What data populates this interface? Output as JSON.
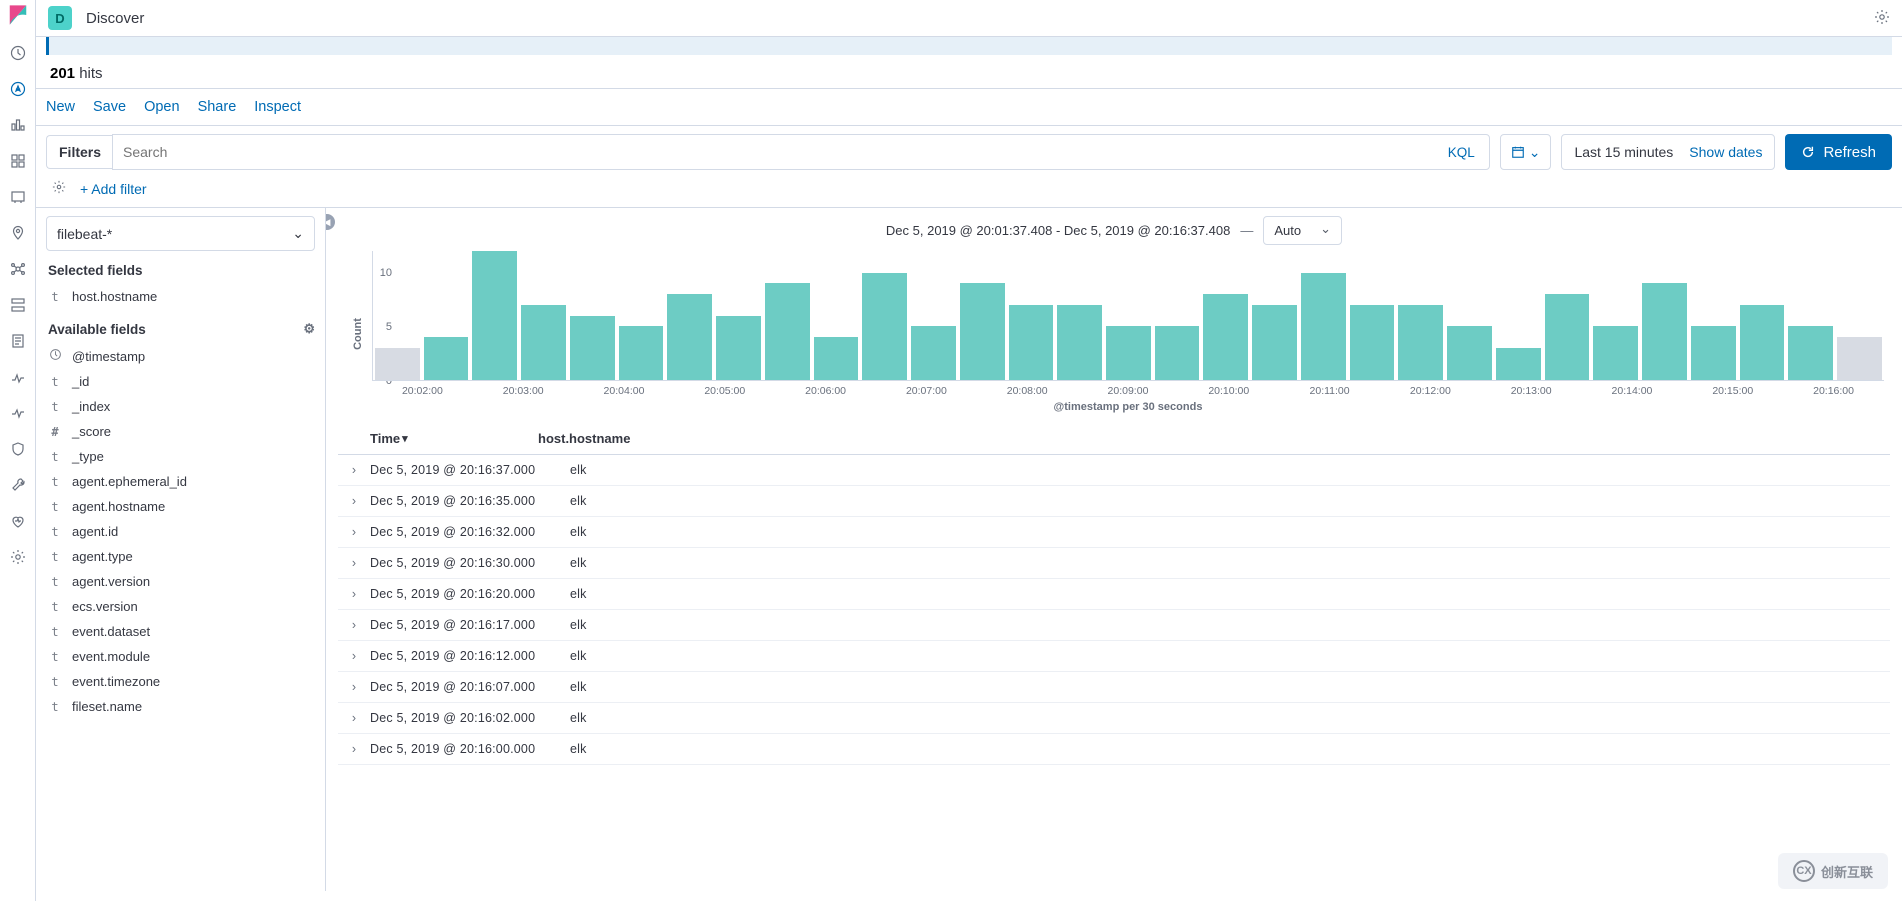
{
  "header": {
    "badge": "D",
    "title": "Discover"
  },
  "hits": {
    "count": "201",
    "label": " hits"
  },
  "toolbar": [
    "New",
    "Save",
    "Open",
    "Share",
    "Inspect"
  ],
  "search": {
    "filters": "Filters",
    "placeholder": "Search",
    "kql": "KQL"
  },
  "date": {
    "range": "Last 15 minutes",
    "show": "Show dates",
    "refresh": "Refresh"
  },
  "addfilter": "+ Add filter",
  "pattern": "filebeat-*",
  "selected_h": "Selected fields",
  "selected": [
    {
      "t": "t",
      "n": "host.hostname"
    }
  ],
  "available_h": "Available fields",
  "available": [
    {
      "t": "clock",
      "n": "@timestamp"
    },
    {
      "t": "t",
      "n": "_id"
    },
    {
      "t": "t",
      "n": "_index"
    },
    {
      "t": "hash",
      "n": "_score"
    },
    {
      "t": "t",
      "n": "_type"
    },
    {
      "t": "t",
      "n": "agent.ephemeral_id"
    },
    {
      "t": "t",
      "n": "agent.hostname"
    },
    {
      "t": "t",
      "n": "agent.id"
    },
    {
      "t": "t",
      "n": "agent.type"
    },
    {
      "t": "t",
      "n": "agent.version"
    },
    {
      "t": "t",
      "n": "ecs.version"
    },
    {
      "t": "t",
      "n": "event.dataset"
    },
    {
      "t": "t",
      "n": "event.module"
    },
    {
      "t": "t",
      "n": "event.timezone"
    },
    {
      "t": "t",
      "n": "fileset.name"
    }
  ],
  "chart_title": "Dec 5, 2019 @ 20:01:37.408 - Dec 5, 2019 @ 20:16:37.408",
  "interval": "Auto",
  "chart_data": {
    "type": "bar",
    "ylabel": "Count",
    "xlabel": "@timestamp per 30 seconds",
    "yticks": [
      0,
      5,
      10
    ],
    "ylim": [
      0,
      12
    ],
    "categories": [
      "20:02:00",
      "20:03:00",
      "20:04:00",
      "20:05:00",
      "20:06:00",
      "20:07:00",
      "20:08:00",
      "20:09:00",
      "20:10:00",
      "20:11:00",
      "20:12:00",
      "20:13:00",
      "20:14:00",
      "20:15:00",
      "20:16:00"
    ],
    "values": [
      3,
      4,
      12,
      7,
      6,
      5,
      8,
      6,
      9,
      4,
      10,
      5,
      9,
      7,
      7,
      5,
      5,
      8,
      7,
      10,
      7,
      7,
      5,
      3,
      8,
      5,
      9,
      5,
      7,
      5,
      4
    ],
    "shaded": [
      0,
      30
    ]
  },
  "table": {
    "h_time": "Time",
    "h_host": "host.hostname",
    "rows": [
      {
        "t": "Dec 5, 2019 @ 20:16:37.000",
        "h": "elk"
      },
      {
        "t": "Dec 5, 2019 @ 20:16:35.000",
        "h": "elk"
      },
      {
        "t": "Dec 5, 2019 @ 20:16:32.000",
        "h": "elk"
      },
      {
        "t": "Dec 5, 2019 @ 20:16:30.000",
        "h": "elk"
      },
      {
        "t": "Dec 5, 2019 @ 20:16:20.000",
        "h": "elk"
      },
      {
        "t": "Dec 5, 2019 @ 20:16:17.000",
        "h": "elk"
      },
      {
        "t": "Dec 5, 2019 @ 20:16:12.000",
        "h": "elk"
      },
      {
        "t": "Dec 5, 2019 @ 20:16:07.000",
        "h": "elk"
      },
      {
        "t": "Dec 5, 2019 @ 20:16:02.000",
        "h": "elk"
      },
      {
        "t": "Dec 5, 2019 @ 20:16:00.000",
        "h": "elk"
      }
    ]
  },
  "watermark": "创新互联"
}
